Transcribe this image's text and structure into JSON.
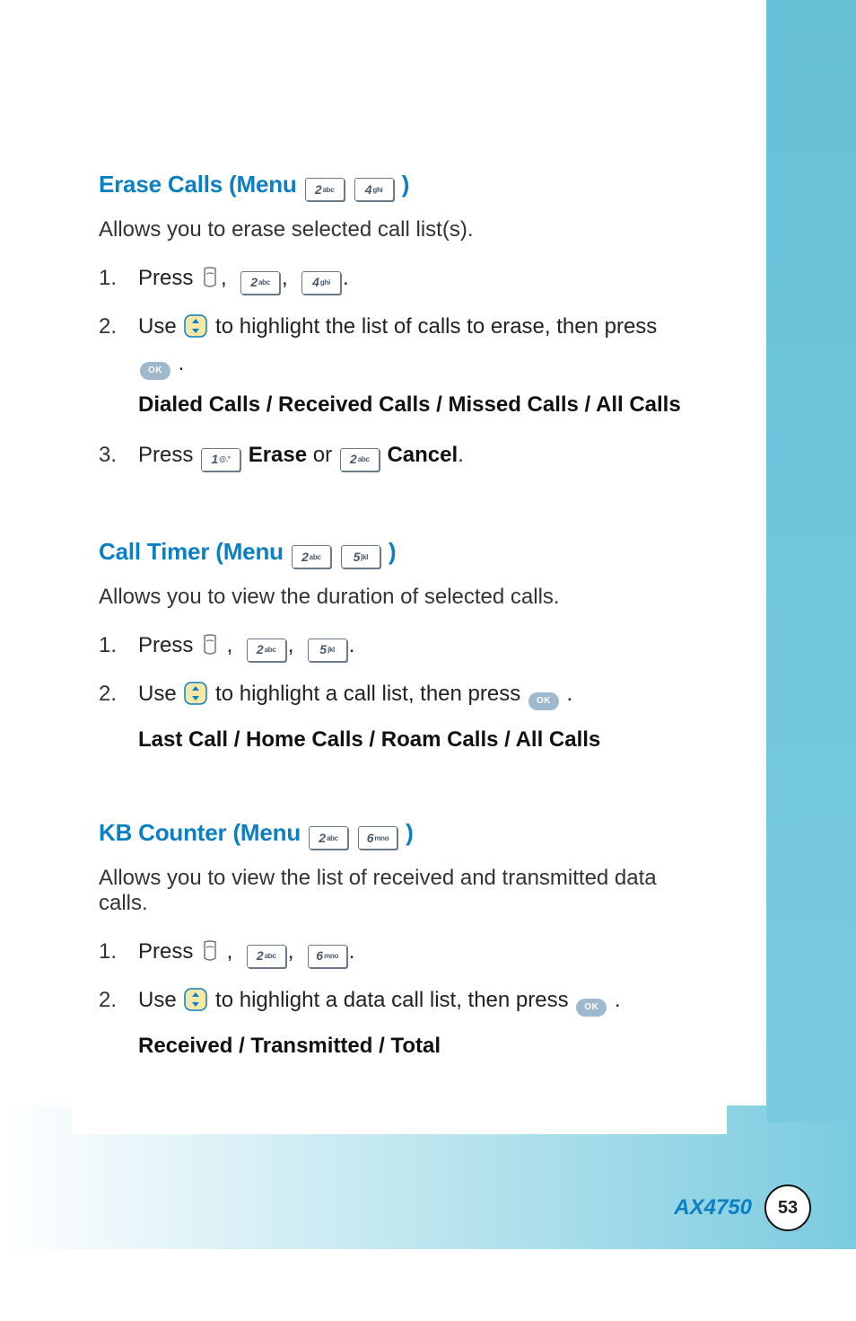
{
  "footer": {
    "model": "AX4750",
    "page": "53"
  },
  "keys": {
    "k1": {
      "digit": "1",
      "letters": "@.°"
    },
    "k2": {
      "digit": "2",
      "letters": "abc"
    },
    "k4": {
      "digit": "4",
      "letters": "ghi"
    },
    "k5": {
      "digit": "5",
      "letters": "jkl"
    },
    "k6": {
      "digit": "6",
      "letters": "mno"
    },
    "ok": "OK"
  },
  "sections": [
    {
      "id": "erase",
      "title_pre": "Erase Calls (Menu ",
      "title_keys": [
        "k2",
        "k4"
      ],
      "title_post": ")",
      "lead": "Allows you to erase selected call list(s).",
      "steps": [
        {
          "n": "1.",
          "pre": "Press ",
          "seq": [
            "soft",
            "comma",
            "k2",
            "comma",
            "k4",
            "period"
          ]
        },
        {
          "n": "2.",
          "pre": "Use ",
          "seq": [
            "nav"
          ],
          "post": " to highlight the list of calls to erase, then press ",
          "line2": [
            "ok",
            "period"
          ]
        },
        {
          "sub": "Dialed Calls / Received Calls / Missed Calls / All Calls"
        },
        {
          "n": "3.",
          "pre": "Press ",
          "seq": [
            "k1"
          ],
          "mid1": " ",
          "bold1": "Erase",
          "mid2": " or ",
          "seq2": [
            "k2"
          ],
          "mid3": " ",
          "bold2": "Cancel",
          "tail": "."
        }
      ]
    },
    {
      "id": "timer",
      "title_pre": "Call Timer (Menu ",
      "title_keys": [
        "k2",
        "k5"
      ],
      "title_post": ")",
      "lead": "Allows you to view the duration of selected calls.",
      "steps": [
        {
          "n": "1.",
          "pre": "Press ",
          "seq": [
            "soft",
            "comma_sp",
            "k2",
            "comma",
            "k5",
            "period"
          ]
        },
        {
          "n": "2.",
          "pre": "Use ",
          "seq": [
            "nav"
          ],
          "post": " to highlight a call list, then press  ",
          "seq2": [
            "ok",
            "period"
          ]
        },
        {
          "sub": "Last Call / Home Calls / Roam Calls / All Calls"
        }
      ]
    },
    {
      "id": "kb",
      "title_pre": "KB Counter (Menu ",
      "title_keys": [
        "k2",
        "k6"
      ],
      "title_post": ")",
      "lead": "Allows you to view the list of received and transmitted data calls.",
      "steps": [
        {
          "n": "1.",
          "pre": "Press ",
          "seq": [
            "soft",
            "comma_sp",
            "k2",
            "comma",
            "k6",
            "period"
          ]
        },
        {
          "n": "2.",
          "pre": "Use ",
          "seq": [
            "nav"
          ],
          "post": " to highlight a data call list, then press  ",
          "seq2": [
            "ok",
            "period"
          ]
        },
        {
          "sub": "Received / Transmitted / Total"
        }
      ]
    }
  ]
}
